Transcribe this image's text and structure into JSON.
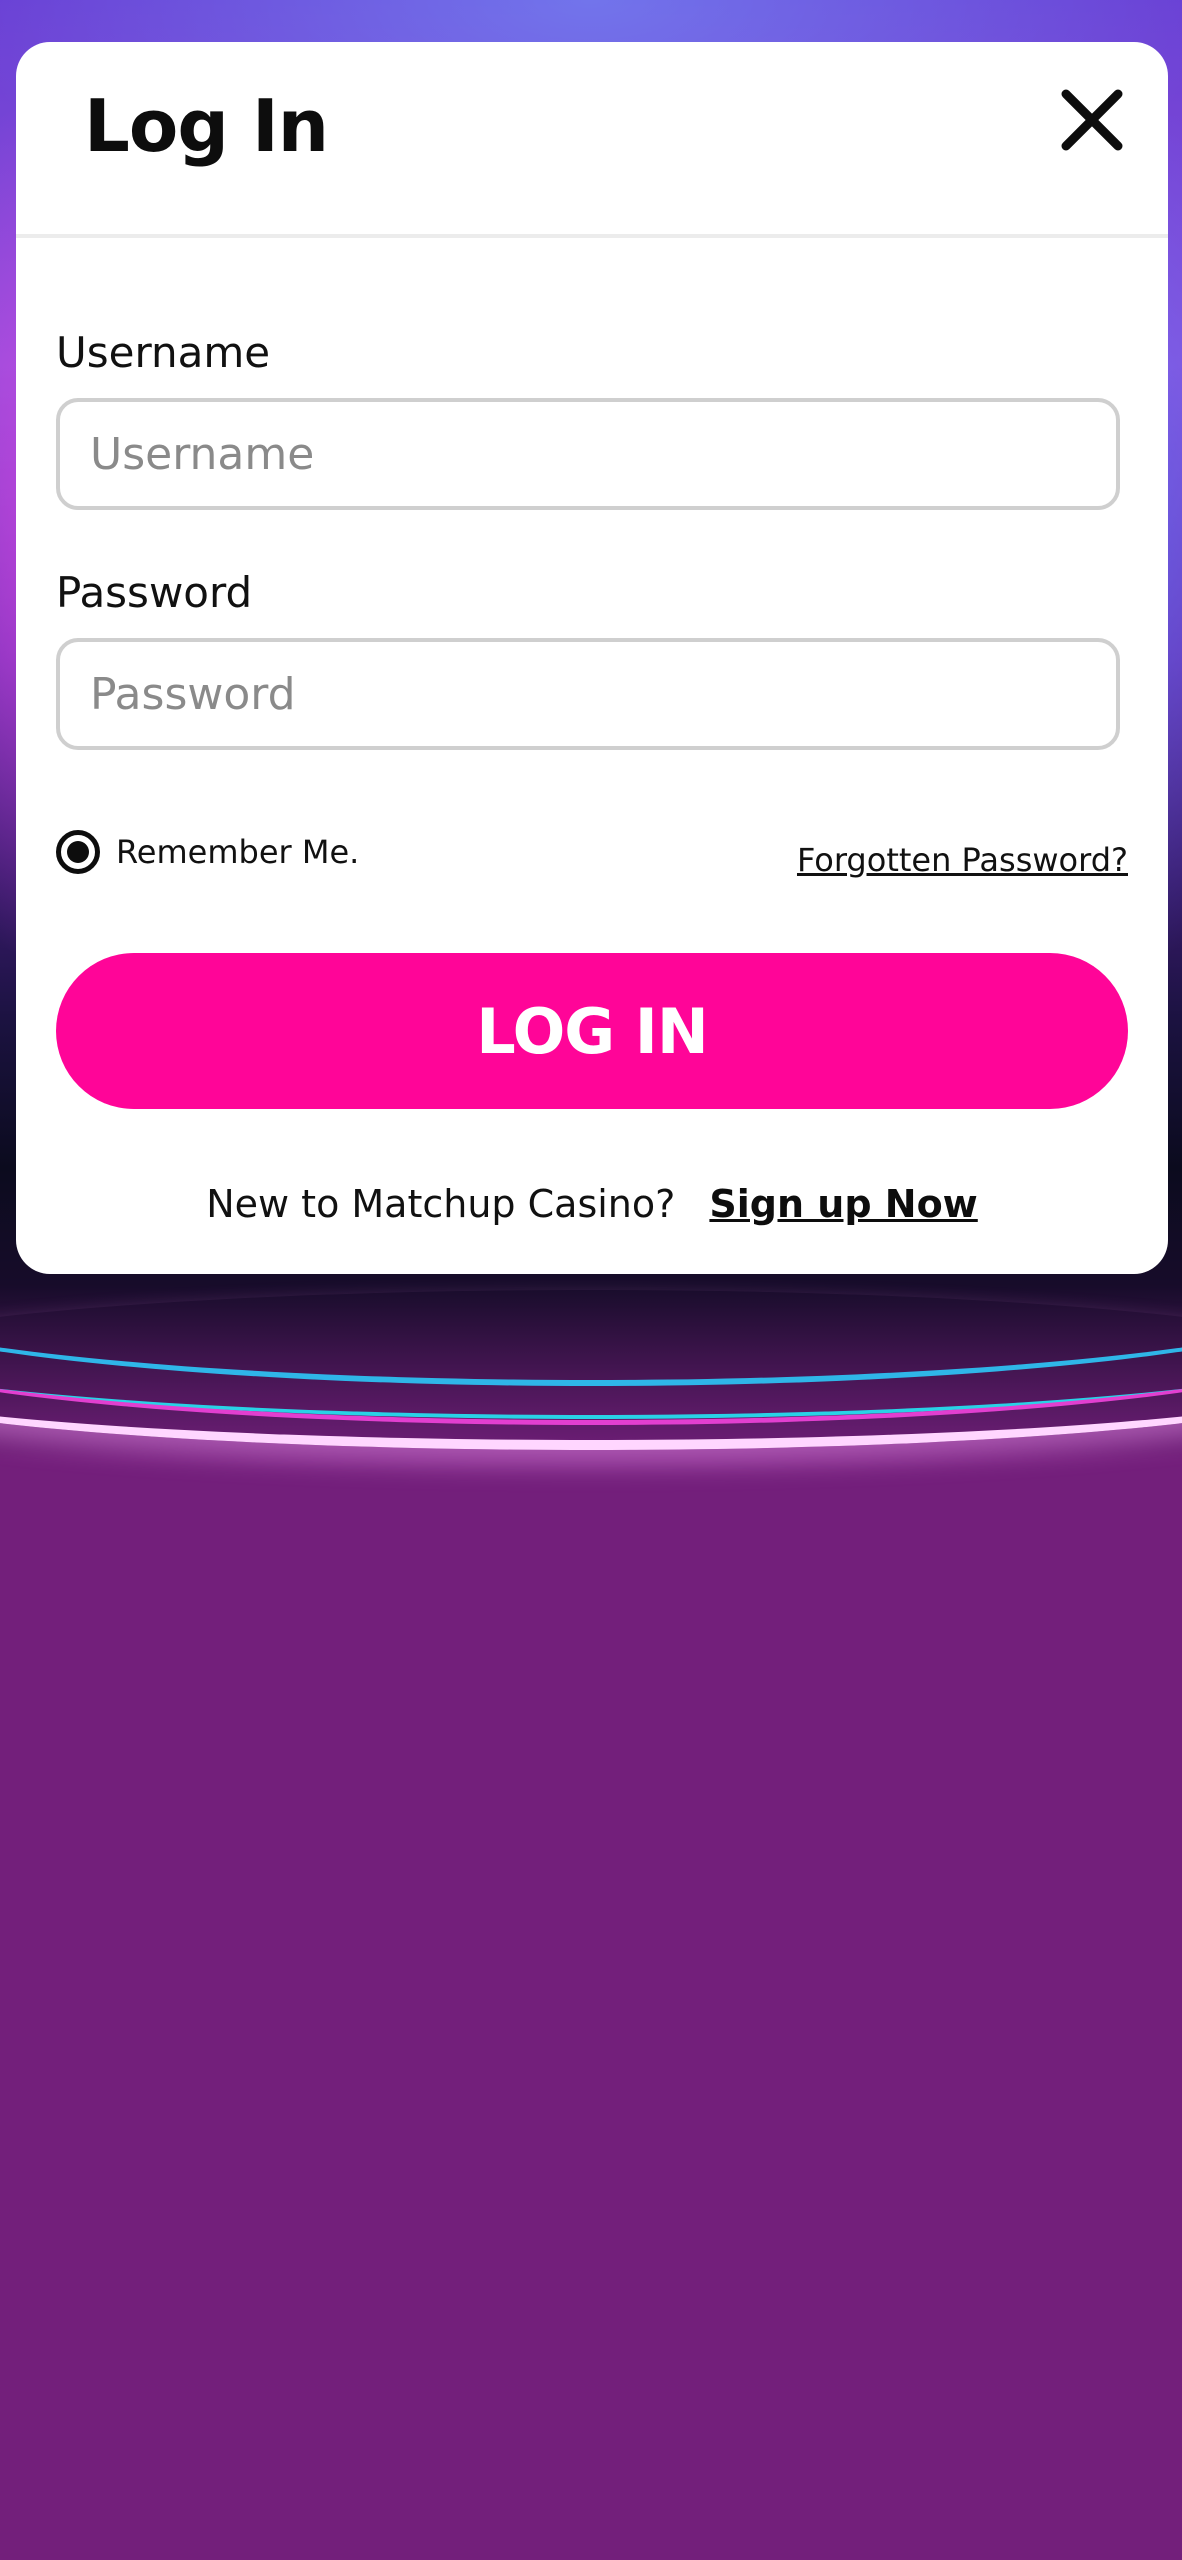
{
  "modal": {
    "title": "Log In",
    "close_icon": "close-icon"
  },
  "form": {
    "username": {
      "label": "Username",
      "placeholder": "Username",
      "value": ""
    },
    "password": {
      "label": "Password",
      "placeholder": "Password",
      "value": ""
    },
    "remember_me": {
      "label": "Remember Me.",
      "checked": true
    },
    "forgot_password_label": "Forgotten Password?",
    "submit_label": "LOG IN"
  },
  "signup": {
    "prompt": "New to Matchup Casino?",
    "link_label": "Sign up Now"
  },
  "colors": {
    "primary_button": "#ff0598",
    "page_background": "#731f7b",
    "modal_background": "#ffffff"
  }
}
